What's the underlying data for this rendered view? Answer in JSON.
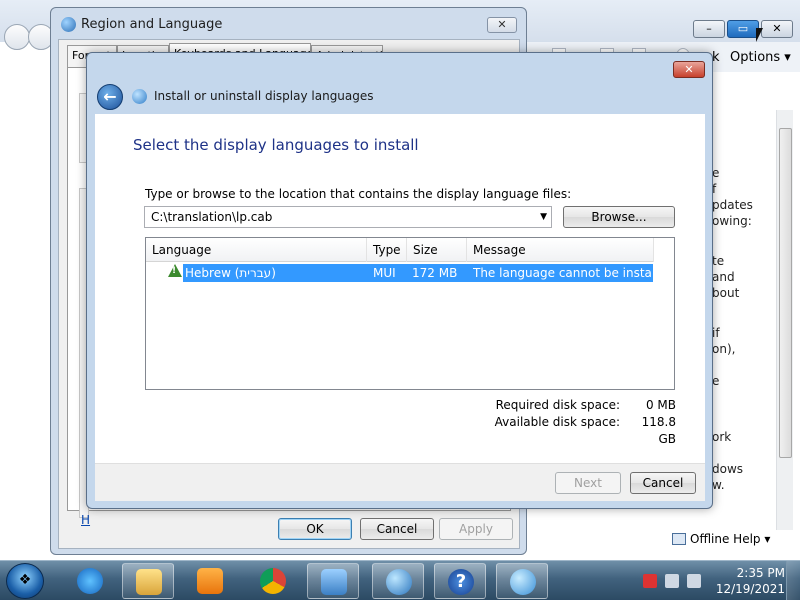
{
  "help_window": {
    "toolbar_partial": "k",
    "options_label": "Options",
    "offline_help_label": "Offline Help",
    "content_fragments": [
      "e",
      "f",
      "pdates",
      "owing:",
      "te",
      "and",
      "bout",
      "if",
      "on),",
      "e",
      "ork",
      "dows",
      "w."
    ]
  },
  "region_dialog": {
    "title": "Region and Language",
    "tabs": [
      "Formats",
      "Location",
      "Keyboards and Languages",
      "Administrative"
    ],
    "link_partial": "H",
    "buttons": {
      "ok": "OK",
      "cancel": "Cancel",
      "apply": "Apply"
    }
  },
  "install_dialog": {
    "title": "Install or uninstall display languages",
    "heading": "Select the display languages to install",
    "location_label": "Type or browse to the location that contains the display language files:",
    "location_value": "C:\\translation\\lp.cab",
    "browse_label": "Browse...",
    "columns": [
      "Language",
      "Type",
      "Size",
      "Message"
    ],
    "rows": [
      {
        "language": "Hebrew (עברית)",
        "type": "MUI",
        "size": "172 MB",
        "message": "The language cannot be install...",
        "status_icon": "warning-icon",
        "selected": true
      }
    ],
    "disk": {
      "required_label": "Required disk space:",
      "required_value": "0 MB",
      "available_label": "Available disk space:",
      "available_value": "118.8 GB"
    },
    "buttons": {
      "next": "Next",
      "cancel": "Cancel"
    }
  },
  "taskbar": {
    "pinned_apps": [
      "internet-explorer-icon",
      "windows-explorer-icon",
      "media-player-icon",
      "chrome-icon",
      "control-panel-icon",
      "network-globe-icon",
      "help-icon",
      "region-language-icon"
    ],
    "time": "2:35 PM",
    "date": "12/19/2021"
  },
  "colors": {
    "heading_blue": "#1e3287",
    "selection_blue": "#3399ff",
    "close_red": "#c7402c"
  }
}
